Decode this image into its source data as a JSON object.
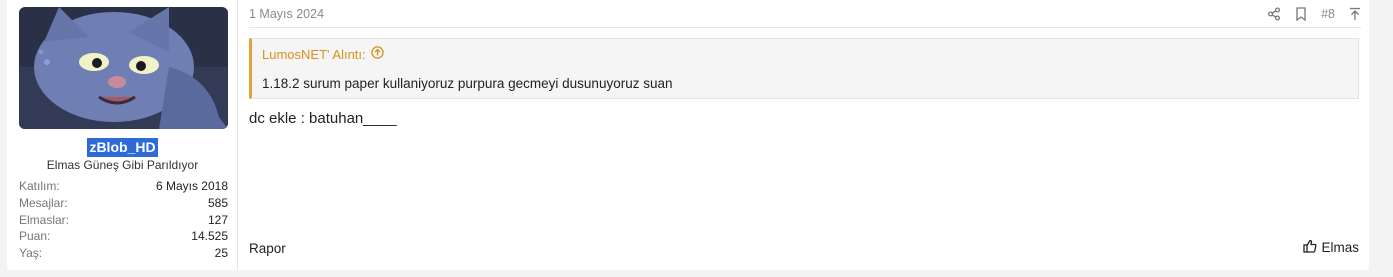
{
  "user": {
    "username": "zBlob_HD",
    "title": "Elmas Güneş Gibi Parıldıyor",
    "stats": [
      {
        "label": "Katılım:",
        "value": "6 Mayıs 2018"
      },
      {
        "label": "Mesajlar:",
        "value": "585"
      },
      {
        "label": "Elmaslar:",
        "value": "127"
      },
      {
        "label": "Puan:",
        "value": "14.525"
      },
      {
        "label": "Yaş:",
        "value": "25"
      }
    ]
  },
  "post": {
    "date": "1 Mayıs 2024",
    "number": "#8",
    "quote": {
      "author": "LumosNET' Alıntı:",
      "text": "1.18.2 surum paper kullaniyoruz purpura gecmeyi dusunuyoruz suan"
    },
    "message": "dc ekle : batuhan____",
    "report_label": "Rapor",
    "reaction_label": "Elmas"
  },
  "colors": {
    "quote_accent": "#e2a13a",
    "username_bg": "#2e6bd6"
  },
  "icons": [
    "share-icon",
    "bookmark-icon",
    "scroll-top-icon",
    "arrow-circle-up-icon",
    "thumbs-up-icon"
  ]
}
